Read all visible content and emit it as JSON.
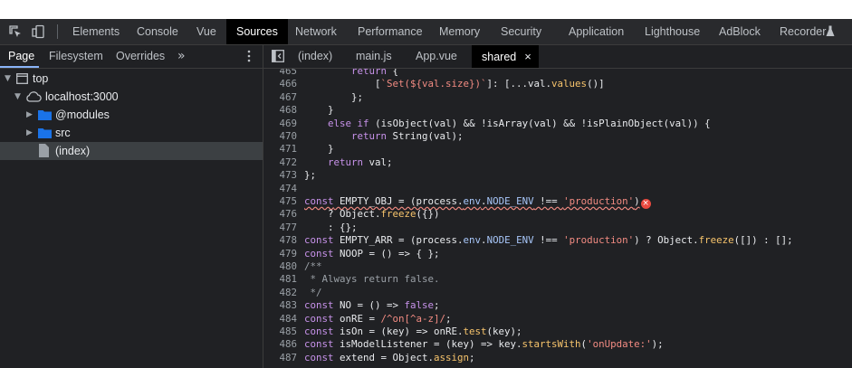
{
  "panel_tabs": [
    {
      "label": "Elements"
    },
    {
      "label": "Console"
    },
    {
      "label": "Vue"
    },
    {
      "label": "Sources",
      "active": true
    },
    {
      "label": "Network"
    },
    {
      "label": "Performance"
    },
    {
      "label": "Memory"
    },
    {
      "label": "Security"
    },
    {
      "label": "Application"
    },
    {
      "label": "Lighthouse"
    },
    {
      "label": "AdBlock"
    },
    {
      "label": "Recorder"
    }
  ],
  "icons": {
    "inspect": "inspect-element-icon",
    "device": "device-toolbar-icon",
    "recorder": "flask-icon",
    "more_tabs": "chevron-double-right-icon",
    "menu": "kebab-menu-icon",
    "toggle_navigator": "toggle-navigator-icon",
    "close_tab": "close-icon"
  },
  "navigator": {
    "tabs": [
      "Page",
      "Filesystem",
      "Overrides"
    ],
    "more_glyph": "»",
    "tree": [
      {
        "label": "top",
        "expanded": true,
        "icon": "frame-icon"
      },
      {
        "label": "localhost:3000",
        "expanded": true,
        "icon": "cloud-icon"
      },
      {
        "label": "@modules",
        "expanded": false,
        "icon": "folder-icon"
      },
      {
        "label": "src",
        "expanded": false,
        "icon": "folder-icon"
      },
      {
        "label": "(index)",
        "selected": true,
        "icon": "file-icon"
      }
    ]
  },
  "editor": {
    "tabs": [
      {
        "label": "(index)"
      },
      {
        "label": "main.js"
      },
      {
        "label": "App.vue"
      },
      {
        "label": "shared",
        "active": true,
        "close": "×"
      }
    ],
    "lines": [
      {
        "n": "465",
        "text": "        return {"
      },
      {
        "n": "466",
        "text": "            [`Set(${val.size})`]: [...val.values()]"
      },
      {
        "n": "467",
        "text": "        };"
      },
      {
        "n": "468",
        "text": "    }"
      },
      {
        "n": "469",
        "text": "    else if (isObject(val) && !isArray(val) && !isPlainObject(val)) {"
      },
      {
        "n": "470",
        "text": "        return String(val);"
      },
      {
        "n": "471",
        "text": "    }"
      },
      {
        "n": "472",
        "text": "    return val;"
      },
      {
        "n": "473",
        "text": "};"
      },
      {
        "n": "474",
        "text": ""
      },
      {
        "n": "475",
        "text": "const EMPTY_OBJ = (process.env.NODE_ENV !== 'production')"
      },
      {
        "n": "476",
        "text": "    ? Object.freeze({})"
      },
      {
        "n": "477",
        "text": "    : {};"
      },
      {
        "n": "478",
        "text": "const EMPTY_ARR = (process.env.NODE_ENV !== 'production') ? Object.freeze([]) : [];"
      },
      {
        "n": "479",
        "text": "const NOOP = () => { };"
      },
      {
        "n": "480",
        "text": "/**"
      },
      {
        "n": "481",
        "text": " * Always return false."
      },
      {
        "n": "482",
        "text": " */"
      },
      {
        "n": "483",
        "text": "const NO = () => false;"
      },
      {
        "n": "484",
        "text": "const onRE = /^on[^a-z]/;"
      },
      {
        "n": "485",
        "text": "const isOn = (key) => onRE.test(key);"
      },
      {
        "n": "486",
        "text": "const isModelListener = (key) => key.startsWith('onUpdate:');"
      },
      {
        "n": "487",
        "text": "const extend = Object.assign;"
      }
    ],
    "error_badge": "×"
  },
  "colors": {
    "active_tab_bg": "#000000",
    "selection": "#3c4043",
    "folder": "#1a73e8",
    "error": "#e8493f"
  }
}
